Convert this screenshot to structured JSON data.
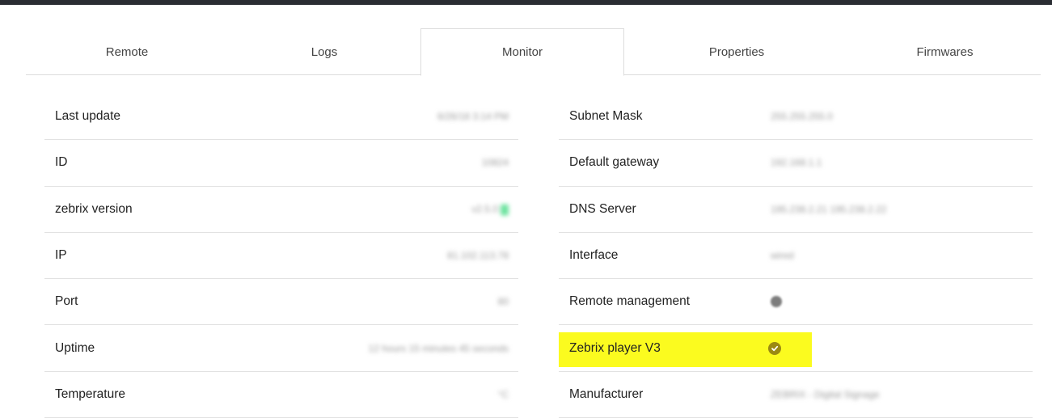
{
  "tabs": [
    {
      "label": "Remote"
    },
    {
      "label": "Logs"
    },
    {
      "label": "Monitor"
    },
    {
      "label": "Properties"
    },
    {
      "label": "Firmwares"
    }
  ],
  "active_tab": "Monitor",
  "left_rows": [
    {
      "label": "Last update",
      "value": "6/26/18 3:14 PM"
    },
    {
      "label": "ID",
      "value": "10824"
    },
    {
      "label": "zebrix version",
      "value": "v2.5.0"
    },
    {
      "label": "IP",
      "value": "81.102.113.78"
    },
    {
      "label": "Port",
      "value": "80"
    },
    {
      "label": "Uptime",
      "value": "12 hours 15 minutes 45 seconds"
    },
    {
      "label": "Temperature",
      "value": "°C"
    }
  ],
  "right_rows": [
    {
      "label": "Subnet Mask",
      "value": "255.255.255.0"
    },
    {
      "label": "Default gateway",
      "value": "192.168.1.1"
    },
    {
      "label": "DNS Server",
      "value": "195.238.2.21 195.238.2.22"
    },
    {
      "label": "Interface",
      "value": "wired"
    },
    {
      "label": "Remote management",
      "value": ""
    },
    {
      "label": "Zebrix player V3",
      "value": ""
    },
    {
      "label": "Manufacturer",
      "value": "ZEBRIX - Digital Signage"
    }
  ],
  "icons": {
    "remote_management": "status-dot-icon",
    "zebrix_player_v3": "check-circle-icon"
  },
  "colors": {
    "highlight": "#fbfb1f",
    "check": "#9b8a12",
    "version_badge": "#6ee3a0"
  }
}
